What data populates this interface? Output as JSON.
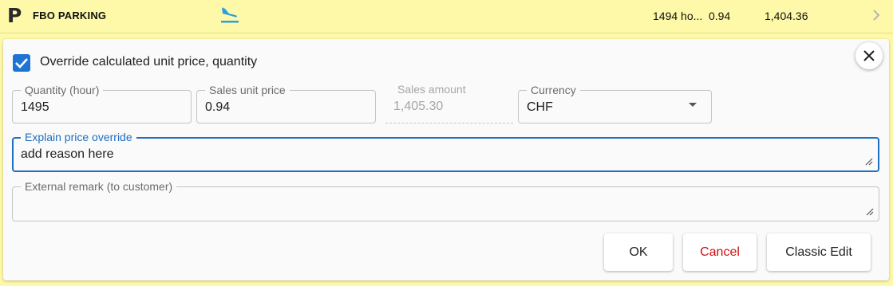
{
  "row": {
    "icon_letter": "P",
    "service_name": "FBO PARKING",
    "service_icon": "airplane-landing-icon",
    "quantity": "1494 ho...",
    "unit_price": "0.94",
    "amount": "1,404.36",
    "expand_icon": "chevron-right-icon"
  },
  "override": {
    "checked": true,
    "label": "Override calculated unit price, quantity",
    "close_icon": "close-icon"
  },
  "fields": {
    "quantity": {
      "label": "Quantity (hour)",
      "value": "1495"
    },
    "unit_price": {
      "label": "Sales unit price",
      "value": "0.94"
    },
    "sales_amount": {
      "label": "Sales amount",
      "value": "1,405.30"
    },
    "currency": {
      "label": "Currency",
      "value": "CHF"
    },
    "explain": {
      "label": "Explain price override",
      "value": "add reason here"
    },
    "external_remark": {
      "label": "External remark (to customer)",
      "value": ""
    }
  },
  "buttons": {
    "ok": "OK",
    "cancel": "Cancel",
    "classic_edit": "Classic Edit"
  },
  "colors": {
    "row_background": "#fdf9a8",
    "accent": "#1e74d3",
    "cancel_text": "#d01010",
    "plane_icon": "#2b9fe0"
  }
}
